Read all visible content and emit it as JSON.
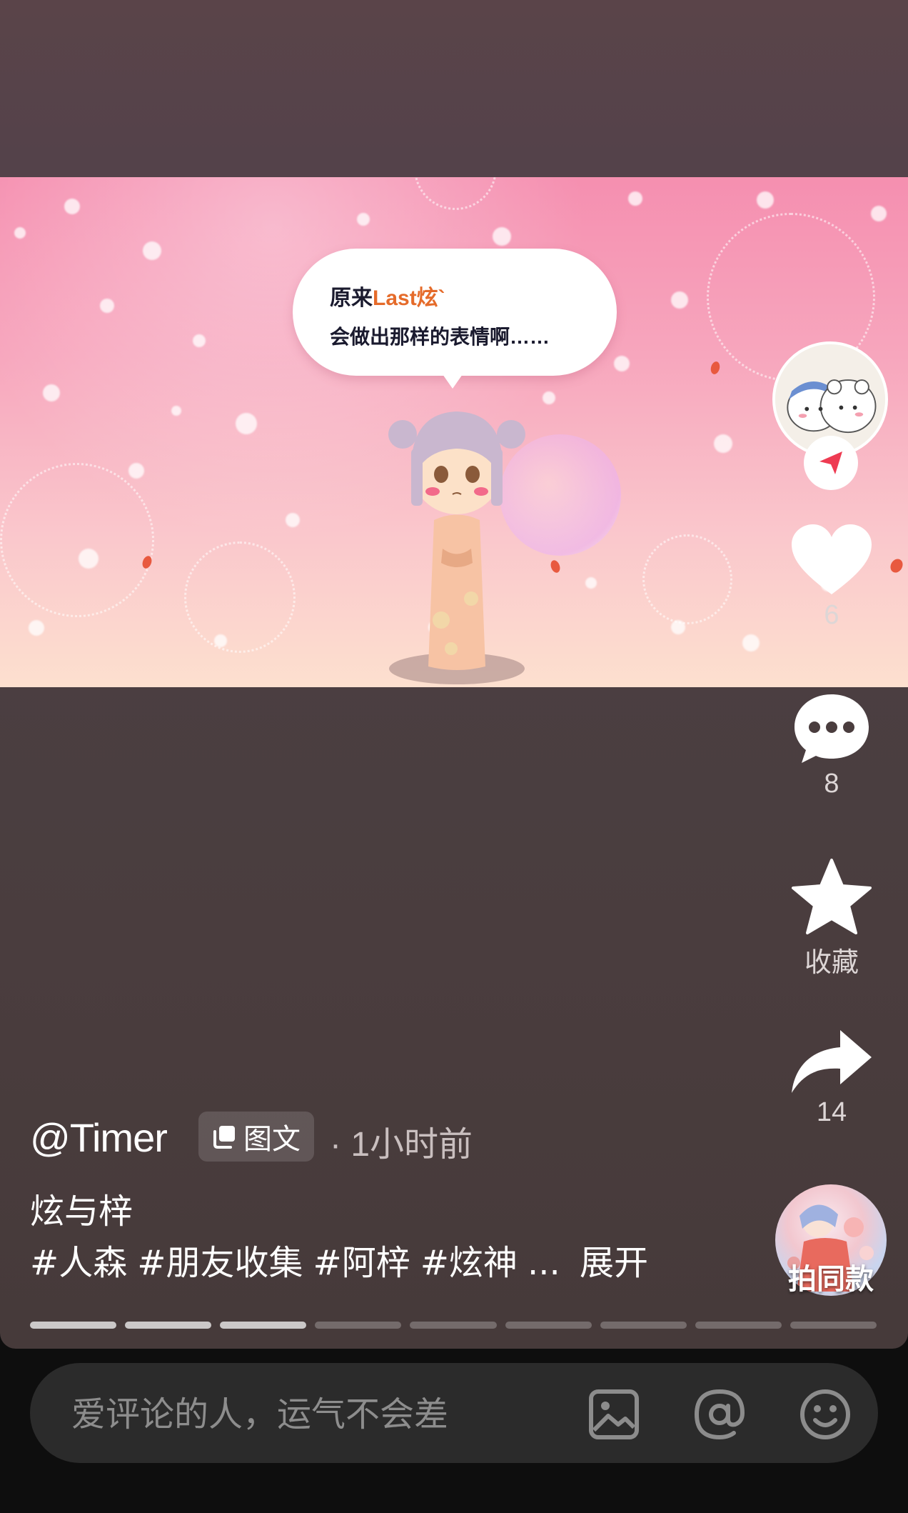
{
  "media": {
    "speech_line1_prefix": "原来",
    "speech_line1_name": "Last炫`",
    "speech_line2": "会做出那样的表情啊……"
  },
  "side_actions": {
    "like_count": "6",
    "comment_count": "8",
    "favorite_label": "收藏",
    "share_count": "14",
    "remix_label": "拍同款"
  },
  "post": {
    "author": "@Timer",
    "type_badge": "图文",
    "time_ago": "· 1小时前",
    "title": "炫与梓",
    "tags": [
      "#人森",
      "#朋友收集",
      "#阿梓",
      "#炫神"
    ],
    "more": "...",
    "expand_label": "展开"
  },
  "progress": {
    "total_pages": 9,
    "current_page": 3
  },
  "comment_bar": {
    "placeholder": "爱评论的人，运气不会差"
  },
  "icons": [
    "send-icon",
    "heart-icon",
    "comment-icon",
    "star-icon",
    "share-icon",
    "image-icon",
    "at-icon",
    "emoji-icon",
    "image-text-icon"
  ],
  "colors": {
    "accent_red": "#ee3b52",
    "name_orange": "#e56b2a"
  }
}
